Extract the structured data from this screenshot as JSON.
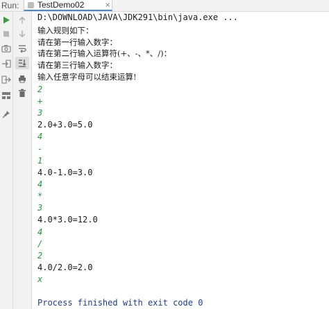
{
  "run_panel": {
    "label": "Run:",
    "tab_title": "TestDemo02",
    "tab_close": "×"
  },
  "toolbar_primary": [
    {
      "name": "run-icon",
      "color": "#3e9b3e"
    },
    {
      "name": "stop-icon",
      "color": "#b7b7b7"
    },
    {
      "name": "camera-icon",
      "color": "#8a8a8a"
    },
    {
      "name": "login-icon",
      "color": "#8a8a8a"
    },
    {
      "name": "exit-icon",
      "color": "#8a8a8a"
    },
    {
      "name": "layout-icon",
      "color": "#7a7a7a"
    },
    {
      "name": "pin-icon",
      "color": "#7a7a7a"
    }
  ],
  "toolbar_secondary": [
    {
      "name": "scroll-up-icon"
    },
    {
      "name": "scroll-down-icon"
    },
    {
      "name": "soft-wrap-icon"
    },
    {
      "name": "scroll-to-end-icon"
    },
    {
      "name": "print-icon"
    },
    {
      "name": "trash-icon"
    }
  ],
  "console": {
    "command": "D:\\DOWNLOAD\\JAVA\\JDK291\\bin\\java.exe ...",
    "lines": [
      {
        "text": "输入规则如下：",
        "kind": "out"
      },
      {
        "text": "请在第一行输入数字：",
        "kind": "out"
      },
      {
        "text": "请在第二行输入运算符(+、-、*、/)：",
        "kind": "out"
      },
      {
        "text": "请在第三行输入数字：",
        "kind": "out"
      },
      {
        "text": "输入任意字母可以结束运算!",
        "kind": "out"
      },
      {
        "text": "2",
        "kind": "in"
      },
      {
        "text": "+",
        "kind": "in"
      },
      {
        "text": "3",
        "kind": "in"
      },
      {
        "text": "2.0+3.0=5.0",
        "kind": "result"
      },
      {
        "text": "4",
        "kind": "in"
      },
      {
        "text": "-",
        "kind": "in"
      },
      {
        "text": "1",
        "kind": "in"
      },
      {
        "text": "4.0-1.0=3.0",
        "kind": "result"
      },
      {
        "text": "4",
        "kind": "in"
      },
      {
        "text": "*",
        "kind": "in"
      },
      {
        "text": "3",
        "kind": "in"
      },
      {
        "text": "4.0*3.0=12.0",
        "kind": "result"
      },
      {
        "text": "4",
        "kind": "in"
      },
      {
        "text": "/",
        "kind": "in"
      },
      {
        "text": "2",
        "kind": "in"
      },
      {
        "text": "4.0/2.0=2.0",
        "kind": "result"
      },
      {
        "text": "x",
        "kind": "in"
      },
      {
        "text": "",
        "kind": "blank"
      },
      {
        "text": "Process finished with exit code 0",
        "kind": "sys"
      }
    ]
  },
  "colors": {
    "input_text": "#1f9a3a",
    "system_text": "#1c3b9e",
    "output_text": "#1a1a1a",
    "tab_underline": "#4a88c7"
  }
}
